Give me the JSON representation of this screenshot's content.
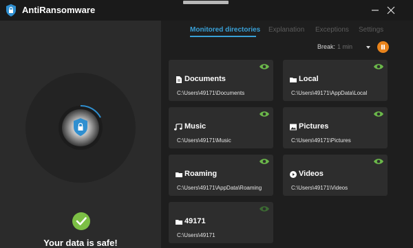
{
  "app": {
    "title": "AntiRansomware"
  },
  "status": {
    "message": "Your data is safe!"
  },
  "tabs": [
    {
      "label": "Monitored directories",
      "active": true
    },
    {
      "label": "Explanation",
      "active": false
    },
    {
      "label": "Exceptions",
      "active": false
    },
    {
      "label": "Settings",
      "active": false
    }
  ],
  "break": {
    "label": "Break:",
    "value": "1 min"
  },
  "directories": [
    {
      "name": "Documents",
      "path": "C:\\Users\\49171\\Documents",
      "icon": "document-icon"
    },
    {
      "name": "Local",
      "path": "C:\\Users\\49171\\AppData\\Local",
      "icon": "folder-icon"
    },
    {
      "name": "Music",
      "path": "C:\\Users\\49171\\Music",
      "icon": "music-icon"
    },
    {
      "name": "Pictures",
      "path": "C:\\Users\\49171\\Pictures",
      "icon": "picture-icon"
    },
    {
      "name": "Roaming",
      "path": "C:\\Users\\49171\\AppData\\Roaming",
      "icon": "folder-icon"
    },
    {
      "name": "Videos",
      "path": "C:\\Users\\49171\\Videos",
      "icon": "video-icon"
    },
    {
      "name": "49171",
      "path": "C:\\Users\\49171",
      "icon": "folder-icon"
    }
  ],
  "colors": {
    "accent": "#39a1d8",
    "eye_active": "#6bb84a",
    "pause": "#e8831b",
    "safe": "#7cbf45"
  }
}
